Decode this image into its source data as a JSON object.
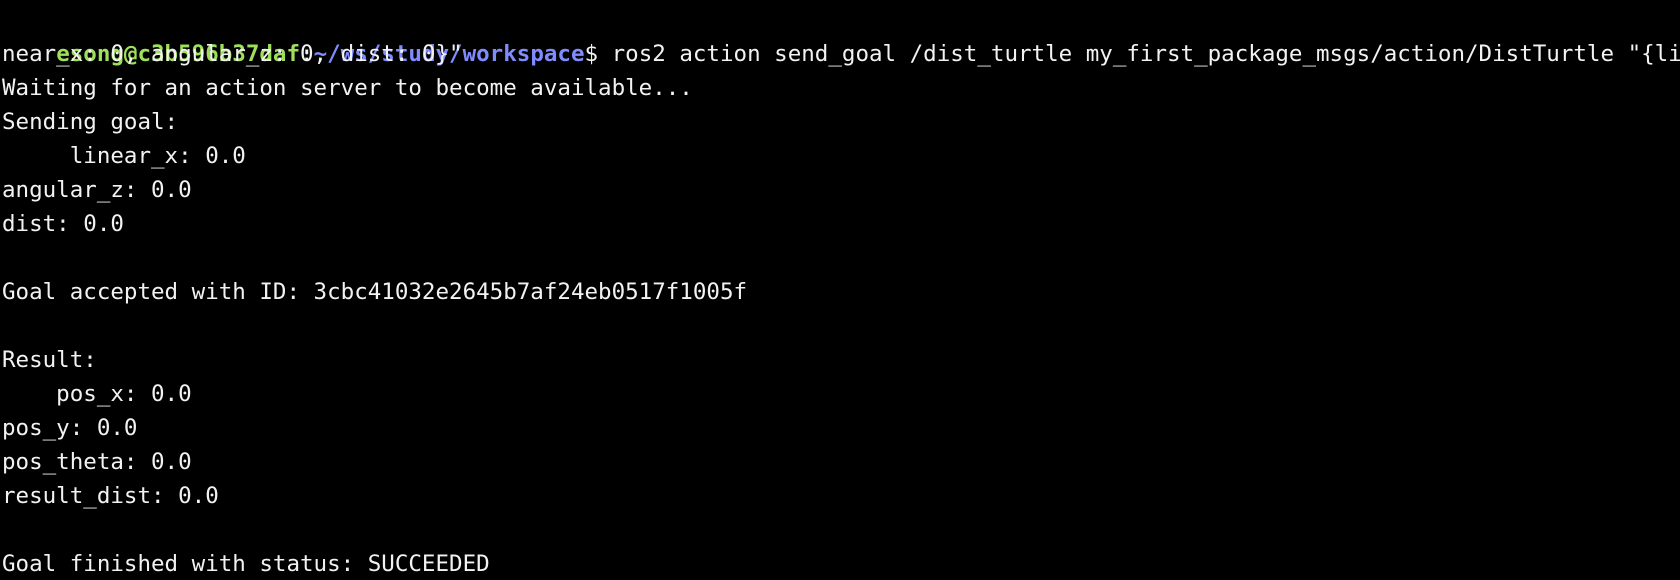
{
  "terminal": {
    "prompt": {
      "user_host": "esong@c3b596b37daf",
      "separator": ":",
      "path": "~/ws/study/workspace",
      "symbol": "$"
    },
    "command": " ros2 action send_goal /dist_turtle my_first_package_msgs/action/DistTurtle \"{li",
    "output_lines": [
      "near_x: 0, angular_z: 0, dist: 0}\"",
      "Waiting for an action server to become available...",
      "Sending goal:",
      "     linear_x: 0.0",
      "angular_z: 0.0",
      "dist: 0.0",
      "",
      "Goal accepted with ID: 3cbc41032e2645b7af24eb0517f1005f",
      "",
      "Result:",
      "    pos_x: 0.0",
      "pos_y: 0.0",
      "pos_theta: 0.0",
      "result_dist: 0.0",
      "",
      "Goal finished with status: SUCCEEDED"
    ],
    "colors": {
      "background": "#000000",
      "text": "#f2f2f2",
      "user_host": "#9ee05a",
      "path": "#7f8bff"
    }
  }
}
